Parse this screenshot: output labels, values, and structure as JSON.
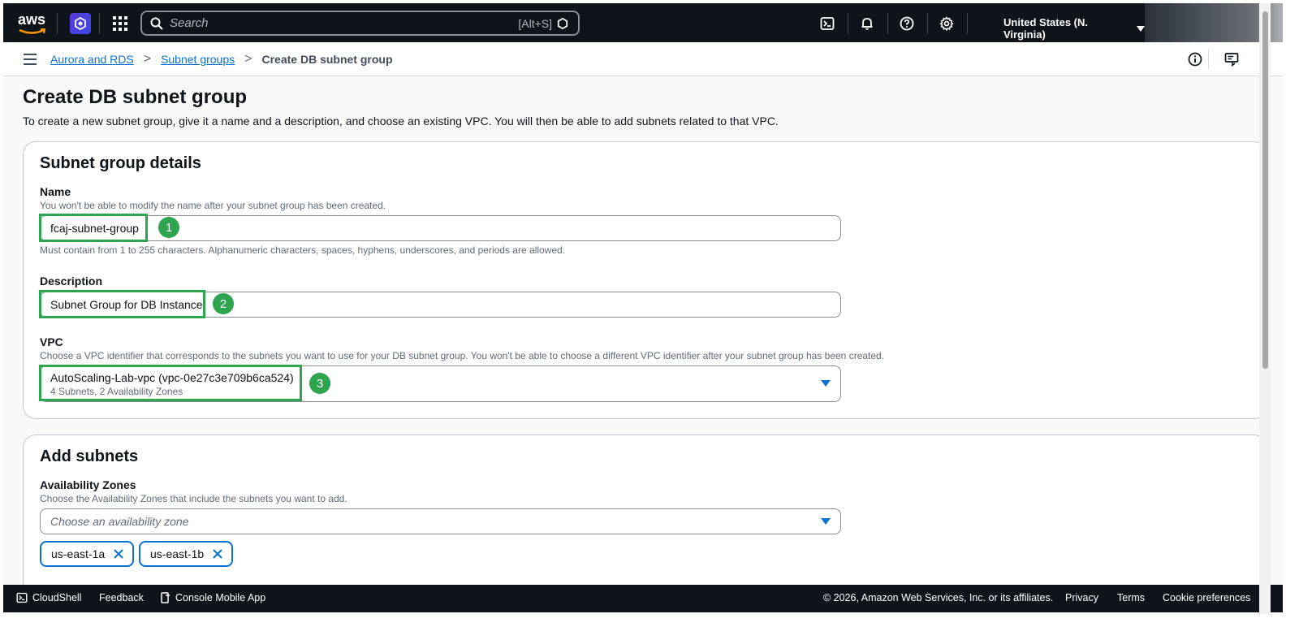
{
  "topnav": {
    "logo_text": "aws",
    "search_placeholder": "Search",
    "search_shortcut": "[Alt+S]",
    "region": "United States (N. Virginia)"
  },
  "breadcrumbs": {
    "items": [
      "Aurora and RDS",
      "Subnet groups"
    ],
    "current": "Create DB subnet group"
  },
  "page": {
    "title": "Create DB subnet group",
    "description": "To create a new subnet group, give it a name and a description, and choose an existing VPC. You will then be able to add subnets related to that VPC."
  },
  "subnet_details": {
    "heading": "Subnet group details",
    "name_label": "Name",
    "name_hint": "You won't be able to modify the name after your subnet group has been created.",
    "name_value": "fcaj-subnet-group",
    "name_constraint": "Must contain from 1 to 255 characters. Alphanumeric characters, spaces, hyphens, underscores, and periods are allowed.",
    "description_label": "Description",
    "description_value": "Subnet Group for DB Instance",
    "vpc_label": "VPC",
    "vpc_hint": "Choose a VPC identifier that corresponds to the subnets you want to use for your DB subnet group. You won't be able to choose a different VPC identifier after your subnet group has been created.",
    "vpc_value": "AutoScaling-Lab-vpc (vpc-0e27c3e709b6ca524)",
    "vpc_sub": "4 Subnets, 2 Availability Zones",
    "markers": [
      "1",
      "2",
      "3"
    ]
  },
  "add_subnets": {
    "heading": "Add subnets",
    "az_label": "Availability Zones",
    "az_hint": "Choose the Availability Zones that include the subnets you want to add.",
    "az_placeholder": "Choose an availability zone",
    "tokens": [
      "us-east-1a",
      "us-east-1b"
    ]
  },
  "footer": {
    "cloudshell": "CloudShell",
    "feedback": "Feedback",
    "mobile_app": "Console Mobile App",
    "copyright": "© 2026, Amazon Web Services, Inc. or its affiliates.",
    "privacy": "Privacy",
    "terms": "Terms",
    "cookies": "Cookie preferences"
  },
  "colors": {
    "nav_bg": "#0f141a",
    "link": "#0972d3",
    "highlight": "#2ea44f"
  }
}
